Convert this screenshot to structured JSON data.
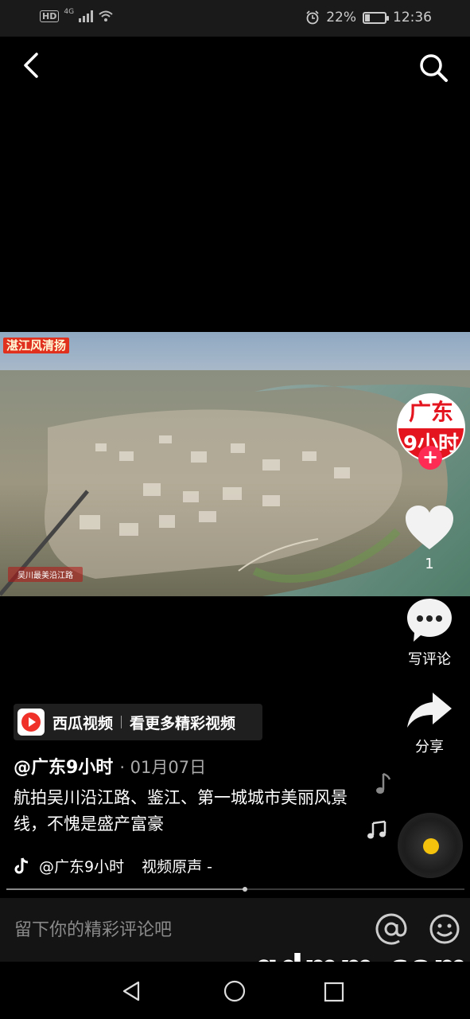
{
  "status_bar": {
    "hd": "HD",
    "network": "4G",
    "battery": "22%",
    "time": "12:36"
  },
  "video": {
    "tag": "湛江风清扬",
    "caption": "吴川最美沿江路"
  },
  "avatar": {
    "line1": "广东",
    "line2": "9小时"
  },
  "rail": {
    "like_count": "1",
    "comment_label": "写评论",
    "share_label": "分享"
  },
  "promo": {
    "app_name": "西瓜视频",
    "cta": "看更多精彩视频"
  },
  "post": {
    "author": "@广东9小时",
    "date": "· 01月07日",
    "description": "航拍吴川沿江路、鉴江、第一城城市美丽风景线，不愧是盛产富豪"
  },
  "music": {
    "author": "@广东9小时",
    "title": "视频原声 -"
  },
  "progress": {
    "fraction": 0.52
  },
  "comment": {
    "placeholder": "留下你的精彩评论吧"
  },
  "watermark": "gdmm.com",
  "colors": {
    "accent": "#fe2c55",
    "brand_red": "#e4151f",
    "disc_center": "#f4c20d"
  }
}
